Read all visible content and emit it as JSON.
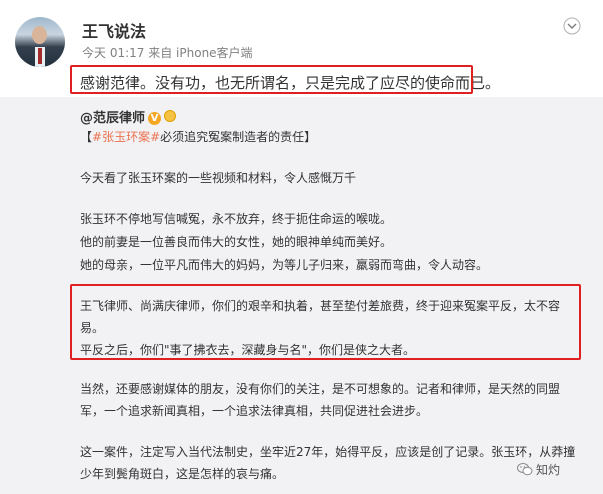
{
  "post": {
    "username": "王飞说法",
    "time": "今天 01:17",
    "source": "来自 iPhone客户端",
    "text": "感谢范律。没有功，也无所谓名，只是完成了应尽的使命而已。"
  },
  "repost": {
    "author": "@范辰律师",
    "topic_open": "【",
    "topic_tag": "#张玉环案#",
    "topic_rest": "必须追究冤案制造者的责任】",
    "lines": [
      "今天看了张玉环案的一些视频和材料，令人感慨万千",
      "张玉环不停地写信喊冤，永不放弃，终于扼住命运的喉咙。",
      "他的前妻是一位善良而伟大的女性，她的眼神单纯而美好。",
      "她的母亲，一位平凡而伟大的妈妈，为等儿子归来，羸弱而弯曲，令人动容。",
      "王飞律师、尚满庆律师，你们的艰辛和执着，甚至垫付差旅费，终于迎来冤案平反，太不容",
      "易。",
      "平反之后，你们\"事了拂衣去，深藏身与名\"，你们是侠之大者。",
      "当然，还要感谢媒体的朋友，没有你们的关注，是不可想象的。记者和律师，是天然的同盟",
      "军，一个追求新闻真相，一个追求法律真相，共同促进社会进步。",
      "这一案件，注定写入当代法制史，坐牢近27年，始得平反，应该是创了记录。张玉环，从莽撞",
      "少年到鬓角斑白，这是怎样的哀与痛。"
    ]
  },
  "watermark": "知灼",
  "icons": {
    "menu": "chevron-down-icon",
    "verified": "verified-v-icon",
    "medal": "medal-icon",
    "watermark": "wechat-icon"
  },
  "colors": {
    "highlight_box": "#e02020",
    "topic_link": "#eb7350",
    "repost_bg": "#f2f2f5",
    "verified_badge": "#f5a623"
  }
}
